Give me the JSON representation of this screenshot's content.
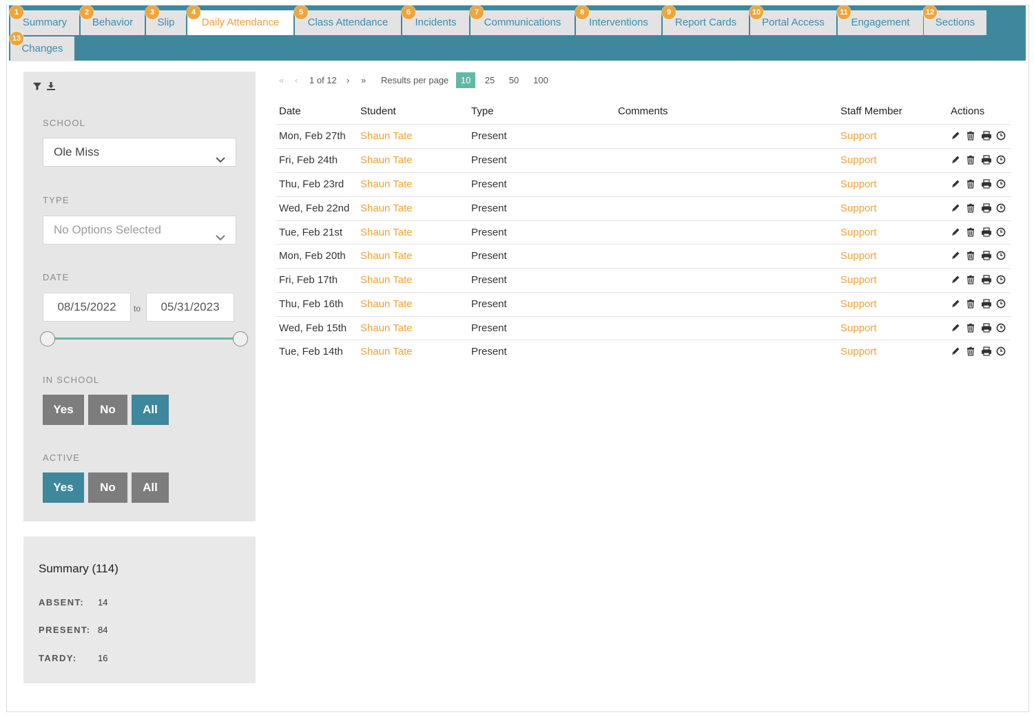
{
  "tabs": [
    {
      "num": "1",
      "label": "Summary"
    },
    {
      "num": "2",
      "label": "Behavior"
    },
    {
      "num": "3",
      "label": "Slip"
    },
    {
      "num": "4",
      "label": "Daily Attendance",
      "active": true
    },
    {
      "num": "5",
      "label": "Class Attendance"
    },
    {
      "num": "6",
      "label": "Incidents"
    },
    {
      "num": "7",
      "label": "Communications"
    },
    {
      "num": "8",
      "label": "Interventions"
    },
    {
      "num": "9",
      "label": "Report Cards"
    },
    {
      "num": "10",
      "label": "Portal Access"
    },
    {
      "num": "11",
      "label": "Engagement"
    },
    {
      "num": "12",
      "label": "Sections"
    },
    {
      "num": "13",
      "label": "Changes"
    }
  ],
  "filters": {
    "school_label": "SCHOOL",
    "school_value": "Ole Miss",
    "type_label": "TYPE",
    "type_placeholder": "No Options Selected",
    "date_label": "DATE",
    "date_from": "08/15/2022",
    "date_to_word": "to",
    "date_to": "05/31/2023",
    "in_school_label": "IN SCHOOL",
    "in_school_options": [
      "Yes",
      "No",
      "All"
    ],
    "in_school_selected": "All",
    "active_label": "ACTIVE",
    "active_options": [
      "Yes",
      "No",
      "All"
    ],
    "active_selected": "Yes"
  },
  "summary": {
    "title": "Summary (114)",
    "stats": [
      {
        "label": "ABSENT:",
        "value": "14"
      },
      {
        "label": "PRESENT:",
        "value": "84"
      },
      {
        "label": "TARDY:",
        "value": "16"
      }
    ]
  },
  "pagination": {
    "first": "«",
    "prev": "‹",
    "page_text": "1 of 12",
    "next": "›",
    "last": "»",
    "per_page_label": "Results per page",
    "per_page_options": [
      "10",
      "25",
      "50",
      "100"
    ],
    "per_page_selected": "10"
  },
  "table": {
    "headers": {
      "date": "Date",
      "student": "Student",
      "type": "Type",
      "comments": "Comments",
      "staff": "Staff Member",
      "actions": "Actions"
    },
    "rows": [
      {
        "date": "Mon, Feb 27th",
        "student": "Shaun Tate",
        "type": "Present",
        "comments": "",
        "staff": "Support"
      },
      {
        "date": "Fri, Feb 24th",
        "student": "Shaun Tate",
        "type": "Present",
        "comments": "",
        "staff": "Support"
      },
      {
        "date": "Thu, Feb 23rd",
        "student": "Shaun Tate",
        "type": "Present",
        "comments": "",
        "staff": "Support"
      },
      {
        "date": "Wed, Feb 22nd",
        "student": "Shaun Tate",
        "type": "Present",
        "comments": "",
        "staff": "Support"
      },
      {
        "date": "Tue, Feb 21st",
        "student": "Shaun Tate",
        "type": "Present",
        "comments": "",
        "staff": "Support"
      },
      {
        "date": "Mon, Feb 20th",
        "student": "Shaun Tate",
        "type": "Present",
        "comments": "",
        "staff": "Support"
      },
      {
        "date": "Fri, Feb 17th",
        "student": "Shaun Tate",
        "type": "Present",
        "comments": "",
        "staff": "Support"
      },
      {
        "date": "Thu, Feb 16th",
        "student": "Shaun Tate",
        "type": "Present",
        "comments": "",
        "staff": "Support"
      },
      {
        "date": "Wed, Feb 15th",
        "student": "Shaun Tate",
        "type": "Present",
        "comments": "",
        "staff": "Support"
      },
      {
        "date": "Tue, Feb 14th",
        "student": "Shaun Tate",
        "type": "Present",
        "comments": "",
        "staff": "Support"
      }
    ],
    "row_action_icons": [
      "pencil-icon",
      "trash-icon",
      "print-icon",
      "clock-icon"
    ]
  },
  "colors": {
    "tabbar": "#3e879c",
    "accent_orange": "#f2a033",
    "link_blue": "#3a8bb4",
    "teal": "#62b8a8"
  }
}
